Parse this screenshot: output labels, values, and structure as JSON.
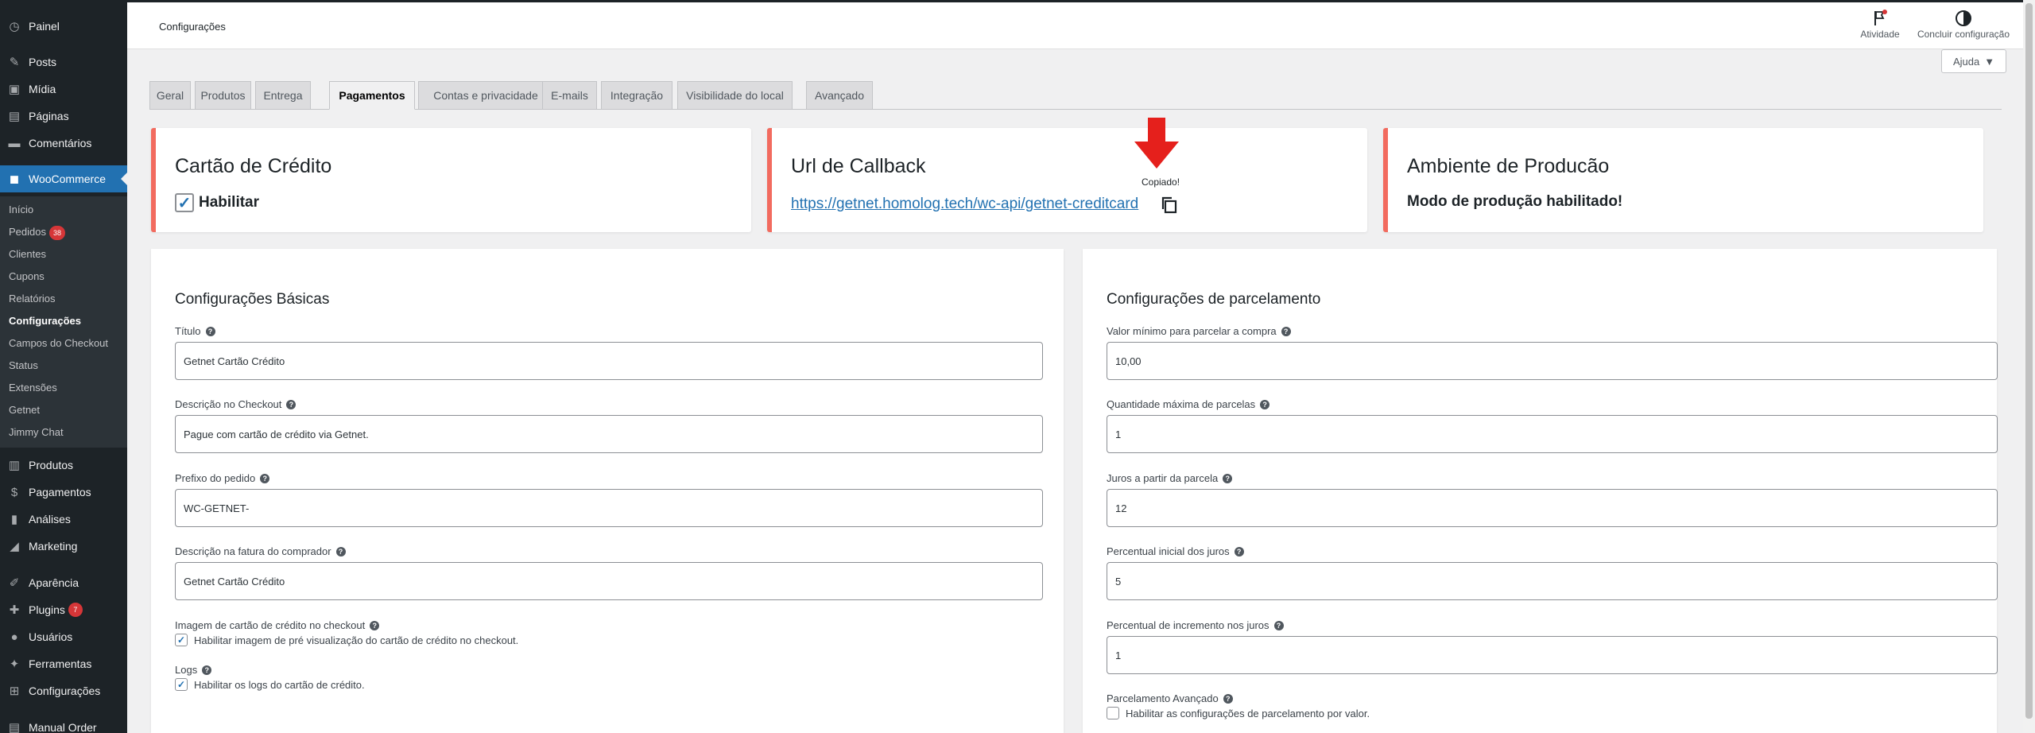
{
  "sidebar": {
    "items": [
      {
        "label": "Painel",
        "icon": "dashboard-icon",
        "glyph": "◷"
      },
      {
        "label": "Posts",
        "icon": "pushpin-icon",
        "glyph": "✎"
      },
      {
        "label": "Mídia",
        "icon": "media-icon",
        "glyph": "▣"
      },
      {
        "label": "Páginas",
        "icon": "pages-icon",
        "glyph": "▤"
      },
      {
        "label": "Comentários",
        "icon": "comments-icon",
        "glyph": "▬"
      },
      {
        "label": "WooCommerce",
        "icon": "woocommerce-icon",
        "glyph": "◼"
      },
      {
        "label": "Produtos",
        "icon": "products-icon",
        "glyph": "▥"
      },
      {
        "label": "Pagamentos",
        "icon": "payments-icon",
        "glyph": "$"
      },
      {
        "label": "Análises",
        "icon": "analytics-icon",
        "glyph": "▮"
      },
      {
        "label": "Marketing",
        "icon": "marketing-icon",
        "glyph": "◢"
      },
      {
        "label": "Aparência",
        "icon": "appearance-icon",
        "glyph": "✐"
      },
      {
        "label": "Plugins",
        "icon": "plugins-icon",
        "glyph": "✚",
        "badge": "7"
      },
      {
        "label": "Usuários",
        "icon": "users-icon",
        "glyph": "●"
      },
      {
        "label": "Ferramentas",
        "icon": "tools-icon",
        "glyph": "✦"
      },
      {
        "label": "Configurações",
        "icon": "settings-icon",
        "glyph": "⊞"
      },
      {
        "label": "Manual Order",
        "icon": "manual-order-icon",
        "glyph": "▤"
      }
    ],
    "submenu": [
      {
        "label": "Início"
      },
      {
        "label": "Pedidos",
        "badge": "38"
      },
      {
        "label": "Clientes"
      },
      {
        "label": "Cupons"
      },
      {
        "label": "Relatórios"
      },
      {
        "label": "Configurações"
      },
      {
        "label": "Campos do Checkout"
      },
      {
        "label": "Status"
      },
      {
        "label": "Extensões"
      },
      {
        "label": "Getnet"
      },
      {
        "label": "Jimmy Chat"
      }
    ]
  },
  "header": {
    "title": "Configurações",
    "activity_label": "Atividade",
    "finish_label": "Concluir configuração",
    "help_label": "Ajuda"
  },
  "tabs": [
    "Geral",
    "Produtos",
    "Entrega",
    "Pagamentos",
    "Contas e privacidade",
    "E-mails",
    "Integração",
    "Visibilidade do local",
    "Avançado"
  ],
  "active_tab": "Pagamentos",
  "cards": {
    "credit_card": {
      "title": "Cartão de Crédito",
      "enable_label": "Habilitar",
      "enabled": true
    },
    "callback": {
      "title": "Url de Callback",
      "url": "https://getnet.homolog.tech/wc-api/getnet-creditcard",
      "copied_label": "Copiado!"
    },
    "environment": {
      "title": "Ambiente de Producão",
      "status": "Modo de produção habilitado!"
    }
  },
  "basic": {
    "title": "Configurações Básicas",
    "fields": [
      {
        "label": "Título",
        "value": "Getnet Cartão Crédito"
      },
      {
        "label": "Descrição no Checkout",
        "value": "Pague com cartão de crédito via Getnet."
      },
      {
        "label": "Prefixo do pedido",
        "value": "WC-GETNET-"
      },
      {
        "label": "Descrição na fatura do comprador",
        "value": "Getnet Cartão Crédito"
      }
    ],
    "card_image_label": "Imagem de cartão de crédito no checkout",
    "card_image_check": "Habilitar imagem de pré visualização do cartão de crédito no checkout.",
    "card_image_checked": true,
    "logs_label": "Logs",
    "logs_check": "Habilitar os logs do cartão de crédito.",
    "logs_checked": true
  },
  "installments": {
    "title": "Configurações de parcelamento",
    "fields": [
      {
        "label": "Valor mínimo para parcelar a compra",
        "value": "10,00"
      },
      {
        "label": "Quantidade máxima de parcelas",
        "value": "1"
      },
      {
        "label": "Juros a partir da parcela",
        "value": "12"
      },
      {
        "label": "Percentual inicial dos juros",
        "value": "5"
      },
      {
        "label": "Percentual de incremento nos juros",
        "value": "1"
      }
    ],
    "advanced_label": "Parcelamento Avançado",
    "advanced_check": "Habilitar as configurações de parcelamento por valor.",
    "advanced_checked": false
  },
  "colors": {
    "accent": "#2271b1",
    "card_border": "#f26b5f",
    "arrow": "#e5201c",
    "sidebar_bg": "#1d2327"
  }
}
